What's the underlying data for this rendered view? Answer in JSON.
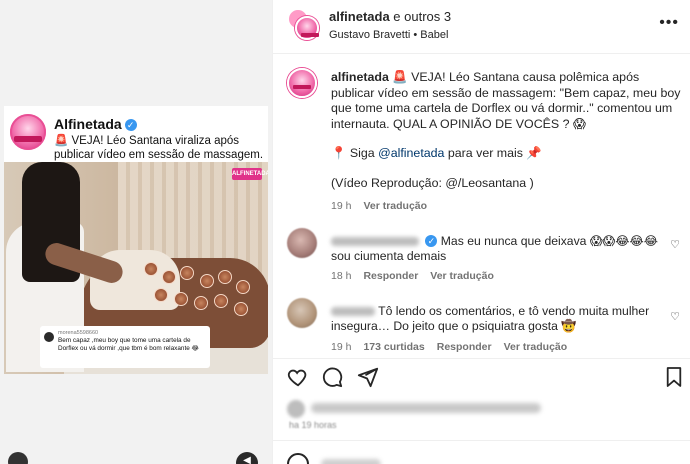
{
  "post_card": {
    "account": "Alfinetada",
    "text": "🚨 VEJA! Léo Santana viraliza após publicar vídeo em sessão de massagem. 😱",
    "photo_badge": "ALFINETADA",
    "overlay_username": "morena5598660",
    "overlay_comment": "Bem capaz ,meu boy que tome uma cartela de Dorflex ou vá dormir ,que tbm é bom relaxante 😂"
  },
  "header": {
    "title_account": "alfinetada",
    "title_rest": " e outros 3",
    "subtitle": "Gustavo Bravetti • Babel",
    "more_icon": "more-horizontal-icon"
  },
  "caption": {
    "username": "alfinetada",
    "text": " 🚨 VEJA! Léo Santana causa polêmica após publicar vídeo em sessão de massagem: \"Bem capaz, meu boy que tome uma cartela de Dorflex ou vá dormir..\" comentou um internauta. QUAL A OPINIÃO DE VOCÊS ? 😱",
    "follow_prefix": "📍 Siga ",
    "follow_handle": "@alfinetada",
    "follow_suffix": " para ver mais 📌",
    "credit": "(Vídeo Reprodução: @/Leosantana )",
    "time": "19 h",
    "see_translation": "Ver tradução"
  },
  "comments": [
    {
      "text": "Mas eu nunca que deixava 😱😱😂😂😂 sou ciumenta demais",
      "time": "18 h",
      "reply": "Responder",
      "see_translation": "Ver tradução"
    },
    {
      "text": "Tô lendo os comentários, e tô vendo muita mulher insegura… Do jeito que o psiquiatra gosta 🤠",
      "time": "19 h",
      "likes": "173 curtidas",
      "reply": "Responder",
      "see_translation": "Ver tradução"
    }
  ],
  "actions": {
    "like_icon": "heart-icon",
    "comment_icon": "comment-icon",
    "share_icon": "share-icon",
    "save_icon": "bookmark-icon"
  },
  "footer": {
    "time_blurred": "ha 19 horas"
  },
  "colors": {
    "accent_pink": "#e94f95",
    "link_blue": "#00376b",
    "verified_blue": "#3897f0",
    "muted": "#737373"
  }
}
